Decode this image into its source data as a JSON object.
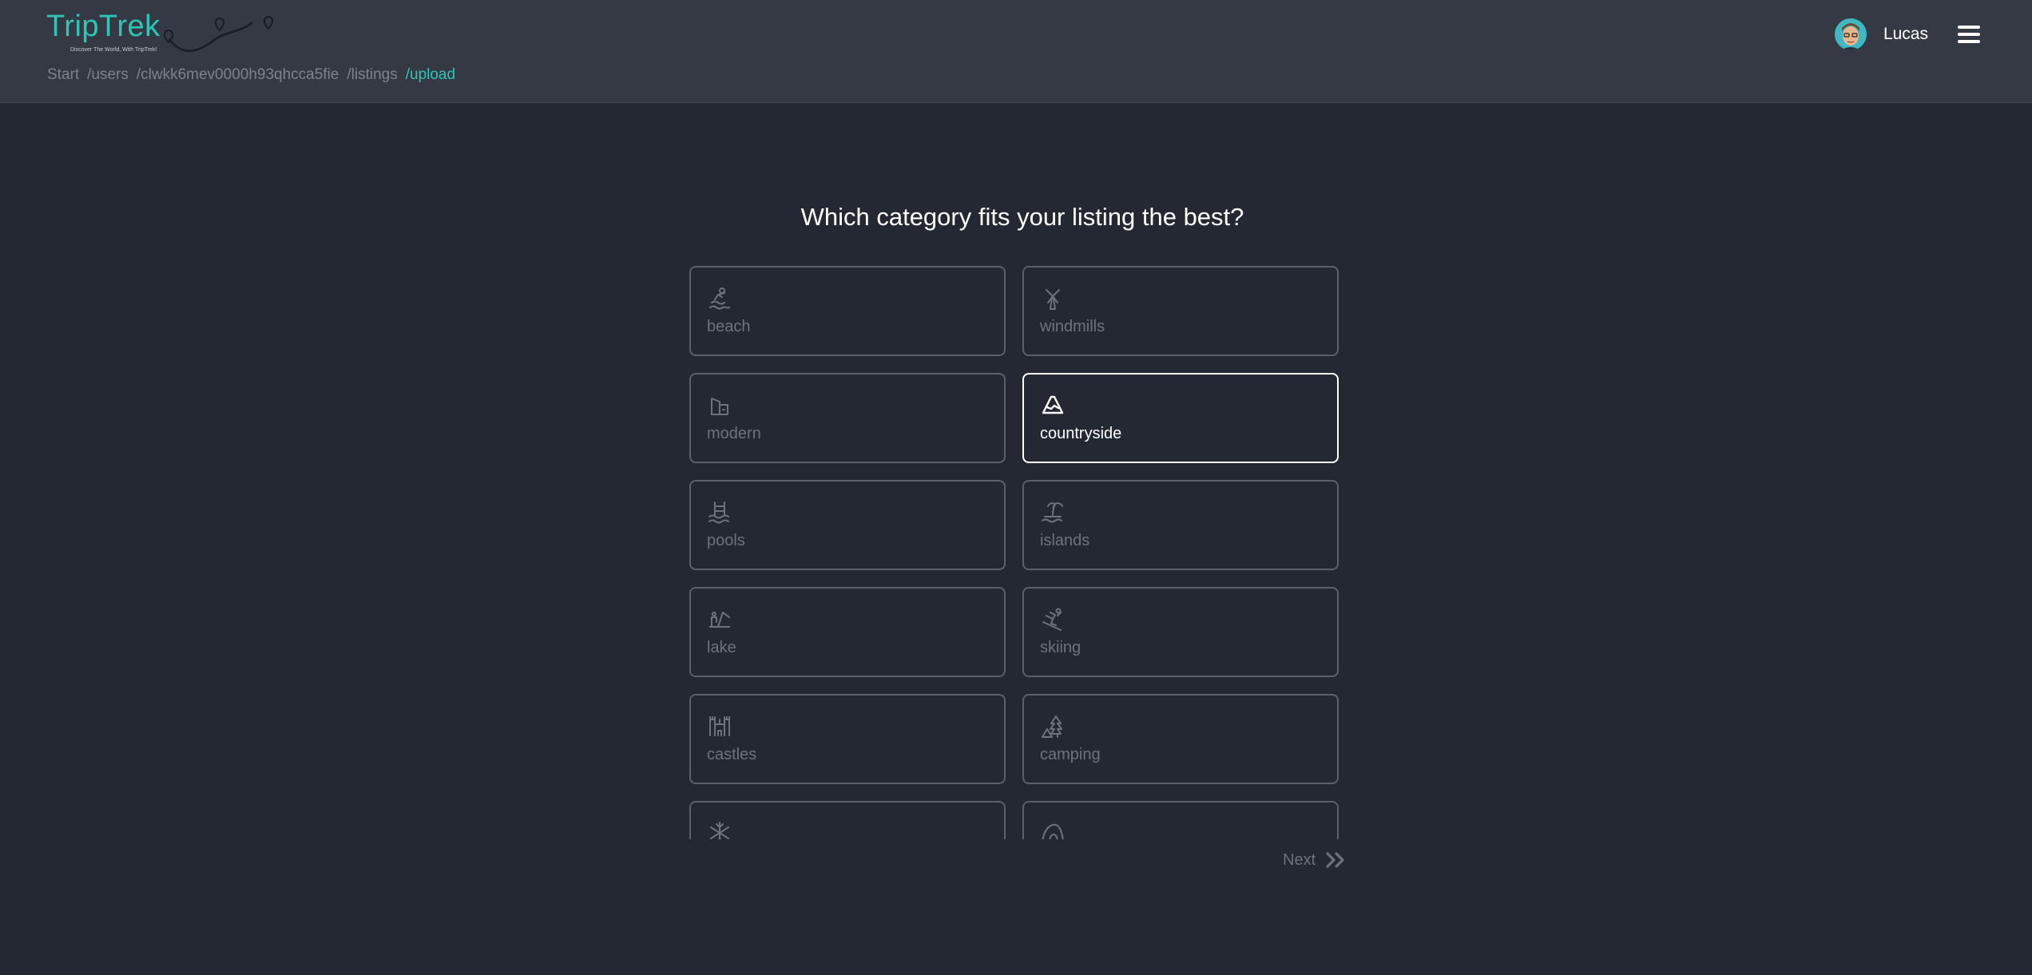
{
  "header": {
    "logo_text": "TripTrek",
    "logo_tagline": "Discover The World, With TripTrek!",
    "breadcrumb": [
      "Start",
      "/users",
      "/clwkk6mev0000h93qhcca5fie",
      "/listings",
      "/upload"
    ],
    "user_name": "Lucas"
  },
  "main": {
    "heading": "Which category fits your listing the best?",
    "categories": [
      {
        "label": "beach",
        "icon": "beach-icon"
      },
      {
        "label": "windmills",
        "icon": "windmill-icon"
      },
      {
        "label": "modern",
        "icon": "modern-building-icon"
      },
      {
        "label": "countryside",
        "icon": "mountain-icon",
        "selected": true
      },
      {
        "label": "pools",
        "icon": "pool-icon"
      },
      {
        "label": "islands",
        "icon": "island-icon"
      },
      {
        "label": "lake",
        "icon": "lake-icon"
      },
      {
        "label": "skiing",
        "icon": "skiing-icon"
      },
      {
        "label": "castles",
        "icon": "castle-icon"
      },
      {
        "label": "camping",
        "icon": "camping-icon"
      },
      {
        "label": "",
        "icon": "snowflake-icon"
      },
      {
        "label": "",
        "icon": "cave-icon"
      }
    ],
    "next_label": "Next"
  },
  "colors": {
    "background": "#232833",
    "header": "#343943",
    "accent": "#2ec4b6",
    "muted": "#6d737c"
  }
}
